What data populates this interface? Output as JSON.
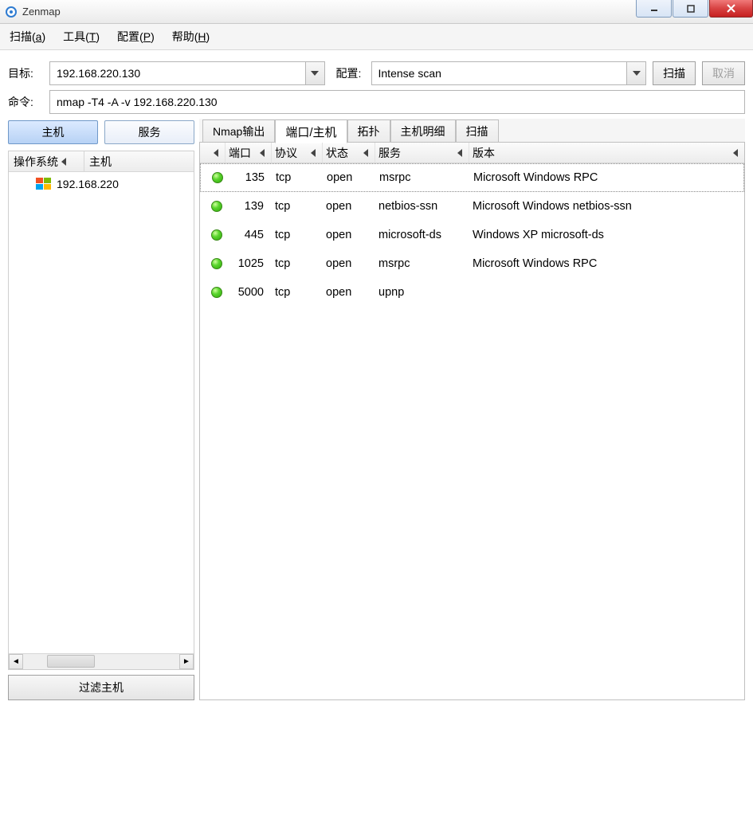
{
  "window": {
    "title": "Zenmap"
  },
  "menubar": {
    "scan": {
      "label": "扫描",
      "mnemonic": "a"
    },
    "tools": {
      "label": "工具",
      "mnemonic": "T"
    },
    "config": {
      "label": "配置",
      "mnemonic": "P"
    },
    "help": {
      "label": "帮助",
      "mnemonic": "H"
    }
  },
  "form": {
    "target_label": "目标:",
    "target_value": "192.168.220.130",
    "profile_label": "配置:",
    "profile_value": "Intense scan",
    "scan_button": "扫描",
    "cancel_button": "取消",
    "command_label": "命令:",
    "command_value": "nmap -T4 -A -v 192.168.220.130"
  },
  "side": {
    "hosts_tab": "主机",
    "services_tab": "服务",
    "column_os": "操作系统",
    "column_host": "主机",
    "items": [
      {
        "host": "192.168.220"
      }
    ],
    "filter_button": "过滤主机"
  },
  "tabs": {
    "nmap_output": "Nmap输出",
    "ports_hosts": "端口/主机",
    "topology": "拓扑",
    "host_details": "主机明细",
    "scans": "扫描"
  },
  "ports_table": {
    "columns": {
      "port": "端口",
      "protocol": "协议",
      "state": "状态",
      "service": "服务",
      "version": "版本"
    },
    "rows": [
      {
        "port": "135",
        "proto": "tcp",
        "state": "open",
        "service": "msrpc",
        "version": "Microsoft Windows RPC"
      },
      {
        "port": "139",
        "proto": "tcp",
        "state": "open",
        "service": "netbios-ssn",
        "version": "Microsoft Windows netbios-ssn"
      },
      {
        "port": "445",
        "proto": "tcp",
        "state": "open",
        "service": "microsoft-ds",
        "version": "Windows XP microsoft-ds"
      },
      {
        "port": "1025",
        "proto": "tcp",
        "state": "open",
        "service": "msrpc",
        "version": "Microsoft Windows RPC"
      },
      {
        "port": "5000",
        "proto": "tcp",
        "state": "open",
        "service": "upnp",
        "version": ""
      }
    ]
  }
}
